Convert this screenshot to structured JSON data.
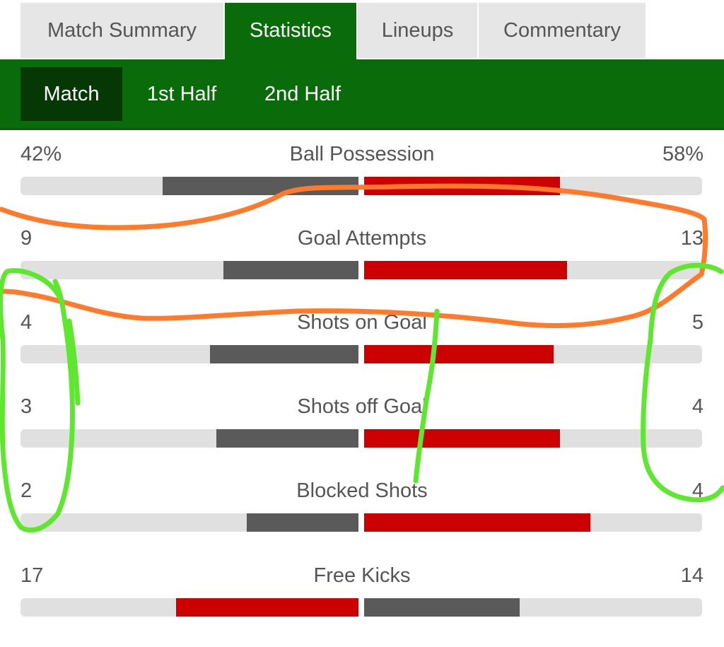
{
  "tabs": [
    {
      "label": "Match Summary",
      "active": false
    },
    {
      "label": "Statistics",
      "active": true
    },
    {
      "label": "Lineups",
      "active": false
    },
    {
      "label": "Commentary",
      "active": false
    }
  ],
  "subtabs": [
    {
      "label": "Match",
      "active": true
    },
    {
      "label": "1st Half",
      "active": false
    },
    {
      "label": "2nd Half",
      "active": false
    }
  ],
  "colors": {
    "brand_green": "#0a6b0a",
    "active_subtab": "#053805",
    "winner_bar": "#cc0000",
    "loser_bar": "#5a5a5a",
    "track": "#e0e0e0",
    "annotation_orange": "#ff7a2a",
    "annotation_green": "#5fe62e"
  },
  "stats": [
    {
      "label": "Ball Possession",
      "home": "42%",
      "away": "58%",
      "home_share": 0.58,
      "away_share": 0.58,
      "home_color": "#5a5a5a",
      "away_color": "#cc0000"
    },
    {
      "label": "Goal Attempts",
      "home": "9",
      "away": "13",
      "home_share": 0.4,
      "away_share": 0.6,
      "home_color": "#5a5a5a",
      "away_color": "#cc0000"
    },
    {
      "label": "Shots on Goal",
      "home": "4",
      "away": "5",
      "home_share": 0.44,
      "away_share": 0.56,
      "home_color": "#5a5a5a",
      "away_color": "#cc0000"
    },
    {
      "label": "Shots off Goal",
      "home": "3",
      "away": "4",
      "home_share": 0.42,
      "away_share": 0.58,
      "home_color": "#5a5a5a",
      "away_color": "#cc0000"
    },
    {
      "label": "Blocked Shots",
      "home": "2",
      "away": "4",
      "home_share": 0.33,
      "away_share": 0.67,
      "home_color": "#5a5a5a",
      "away_color": "#cc0000"
    },
    {
      "label": "Free Kicks",
      "home": "17",
      "away": "14",
      "home_share": 0.54,
      "away_share": 0.46,
      "home_color": "#cc0000",
      "away_color": "#5a5a5a"
    }
  ]
}
